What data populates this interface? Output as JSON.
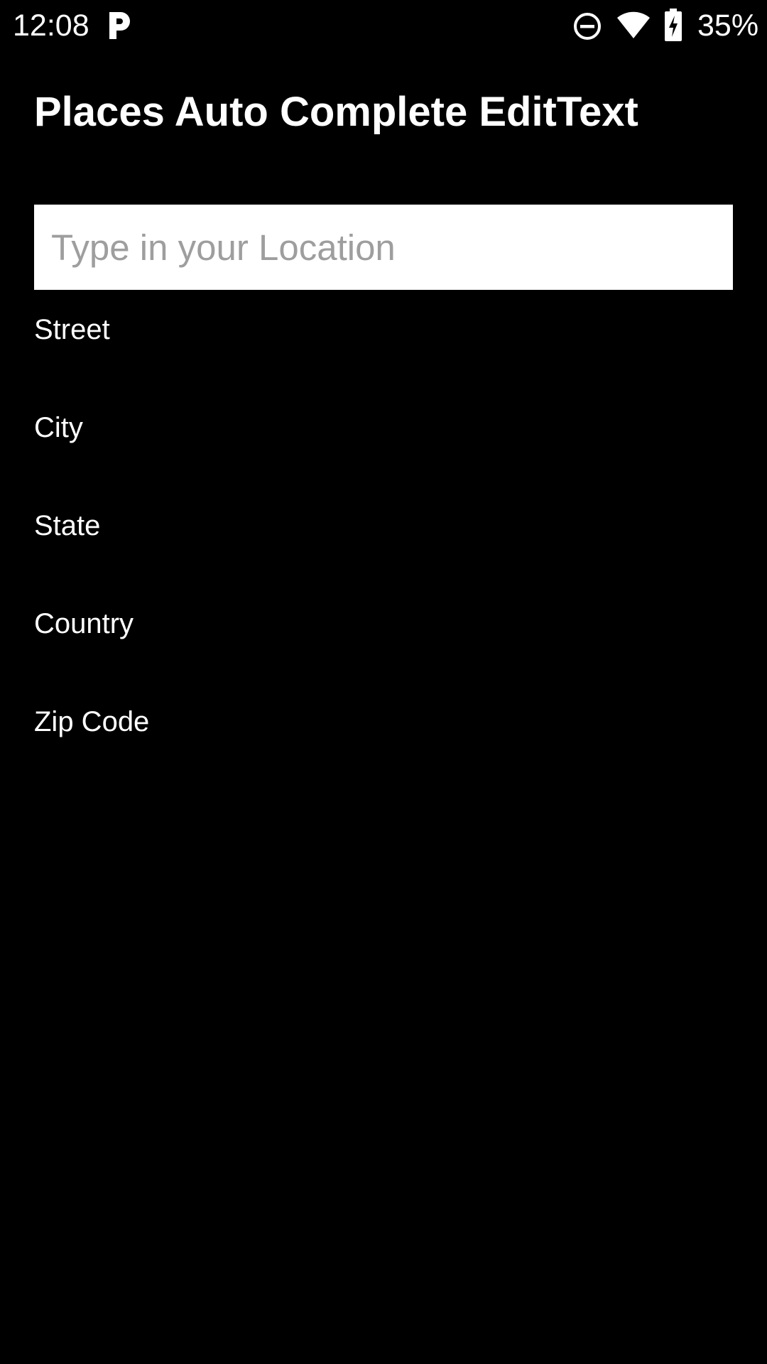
{
  "status_bar": {
    "time": "12:08",
    "battery_percent": "35%",
    "icons": [
      "parking-app-icon",
      "do-not-disturb-icon",
      "wifi-icon",
      "battery-charging-icon"
    ]
  },
  "page": {
    "title": "Places Auto Complete EditText"
  },
  "search": {
    "placeholder": "Type in your Location",
    "value": ""
  },
  "fields": {
    "street": "Street",
    "city": "City",
    "state": "State",
    "country": "Country",
    "zip": "Zip Code"
  },
  "colors": {
    "background": "#000000",
    "text": "#ffffff",
    "input_background": "#ffffff",
    "placeholder": "#9e9e9e"
  }
}
